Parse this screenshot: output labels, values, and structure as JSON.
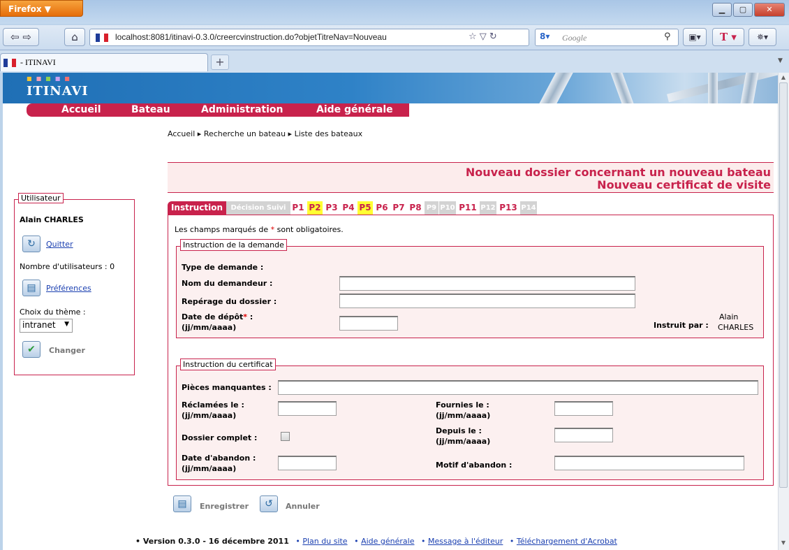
{
  "browser": {
    "app_button": "Firefox ▼",
    "url": "localhost:8081/itinavi-0.3.0/creercvinstruction.do?objetTitreNav=Nouveau",
    "search_engine": "Google",
    "tab_title": " - ITINAVI",
    "new_tab": "+"
  },
  "site": {
    "logo": "ITINAVI",
    "menu": [
      "Accueil",
      "Bateau",
      "Administration",
      "Aide générale"
    ],
    "breadcrumb": [
      "Accueil",
      "Recherche un bateau",
      "Liste des bateaux"
    ],
    "title_line1": "Nouveau dossier concernant un nouveau bateau",
    "title_line2": "Nouveau certificat de visite"
  },
  "user_panel": {
    "legend": "Utilisateur",
    "name": "Alain CHARLES",
    "quit_label": "Quitter",
    "user_count": "Nombre d'utilisateurs : 0",
    "preferences_label": "Préférences",
    "theme_label": "Choix du thème :",
    "theme_value": "intranet",
    "change_label": "Changer"
  },
  "tabs": {
    "instruction": "Instruction",
    "decision": "Décision Suivi",
    "pages": [
      "P1",
      "P2",
      "P3",
      "P4",
      "P5",
      "P6",
      "P7",
      "P8",
      "P9",
      "P10",
      "P11",
      "P12",
      "P13",
      "P14"
    ]
  },
  "form": {
    "required_note_a": "Les champs marqués de",
    "required_star": "*",
    "required_note_b": "sont obligatoires.",
    "demande": {
      "legend": "Instruction de la demande",
      "type_label": "Type de demande :",
      "nom_label": "Nom du demandeur :",
      "reperage_label": "Repérage du dossier :",
      "date_depot_label": "Date de dépôt",
      "date_depot_suffix": " :",
      "date_format": "(jj/mm/aaaa)",
      "instruit_label": "Instruit par :",
      "instruit_line1": "Alain",
      "instruit_line2": "CHARLES"
    },
    "certificat": {
      "legend": "Instruction du certificat",
      "pieces_label": "Pièces manquantes :",
      "reclamees_label": "Réclamées le :",
      "fournies_label": "Fournies le :",
      "complet_label": "Dossier complet :",
      "depuis_label": "Depuis le :",
      "abandon_label": "Date d'abandon :",
      "motif_label": "Motif d'abandon :",
      "date_format": "(jj/mm/aaaa)"
    },
    "save_label": "Enregistrer",
    "cancel_label": "Annuler"
  },
  "footer": {
    "version": "• Version 0.3.0 - 16 décembre 2011",
    "links": [
      "Plan du site",
      "Aide générale",
      "Message à l'éditeur",
      "Téléchargement d'Acrobat"
    ]
  },
  "colors": {
    "brand_red": "#c8224c",
    "highlight_yellow": "#ffff33",
    "disabled_gray": "#d3d3d3",
    "banner_blue": "#1f6fb5"
  }
}
